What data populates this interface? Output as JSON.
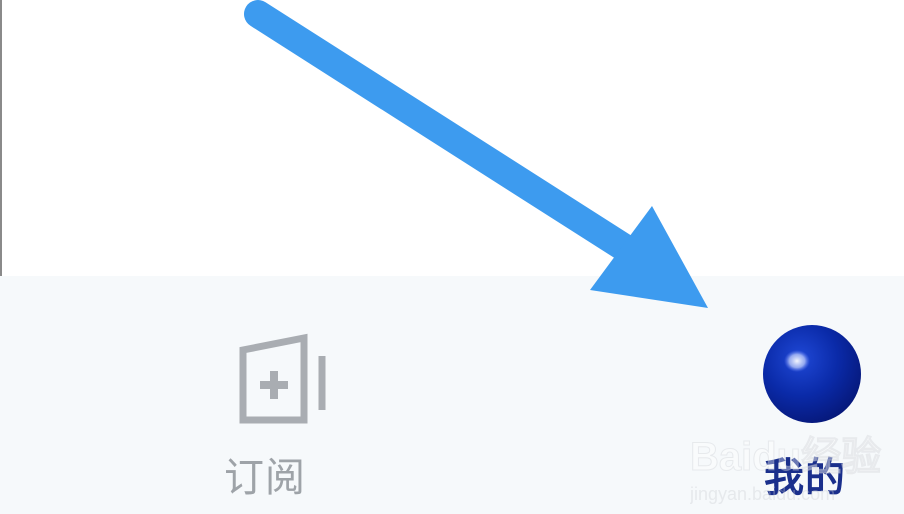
{
  "tab_bar": {
    "subscribe": {
      "label": "订阅",
      "icon": "add-subscription-icon",
      "color": "#9ea3a8"
    },
    "mine": {
      "label": "我的",
      "icon": "avatar-sphere-icon",
      "color": "#1a2f8c",
      "avatar_color": "#0a2aa8"
    }
  },
  "annotation": {
    "arrow": "pointer-arrow",
    "arrow_color": "#3d9bef"
  },
  "watermark": {
    "brand": "Baidu经验",
    "url": "jingyan.baidu.com"
  },
  "colors": {
    "background": "#ffffff",
    "tab_bar_background": "#f6f9fb"
  }
}
